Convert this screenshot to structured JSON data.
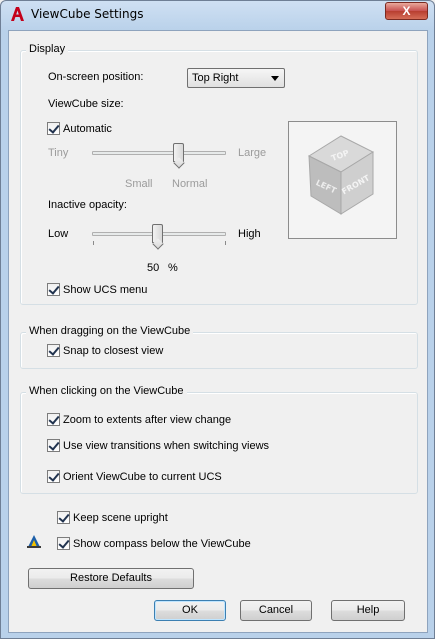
{
  "window": {
    "title": "ViewCube Settings",
    "close_label": "X"
  },
  "display": {
    "group_label": "Display",
    "position_label": "On-screen position:",
    "position_value": "Top Right",
    "size_label": "ViewCube size:",
    "automatic_label": "Automatic",
    "automatic_checked": true,
    "size_min": "Tiny",
    "size_max": "Large",
    "size_small": "Small",
    "size_normal": "Normal",
    "opacity_label": "Inactive opacity:",
    "opacity_min": "Low",
    "opacity_max": "High",
    "opacity_value": "50",
    "opacity_unit": "%",
    "show_ucs_label": "Show UCS menu",
    "show_ucs_checked": true,
    "cube_faces": {
      "top": "TOP",
      "left": "LEFT",
      "front": "FRONT"
    }
  },
  "dragging": {
    "group_label": "When dragging on the ViewCube",
    "snap_label": "Snap to closest view",
    "snap_checked": true
  },
  "clicking": {
    "group_label": "When clicking on the ViewCube",
    "zoom_label": "Zoom to extents after view change",
    "transitions_label": "Use view transitions when switching views",
    "orient_label": "Orient ViewCube to current UCS"
  },
  "misc": {
    "keep_upright_label": "Keep scene upright",
    "show_compass_label": "Show compass below the ViewCube"
  },
  "buttons": {
    "restore": "Restore Defaults",
    "ok": "OK",
    "cancel": "Cancel",
    "help": "Help"
  },
  "colors": {
    "accent": "#c4001a",
    "titlebar": "#b9d1ea",
    "dialog": "#f0f0f0"
  }
}
